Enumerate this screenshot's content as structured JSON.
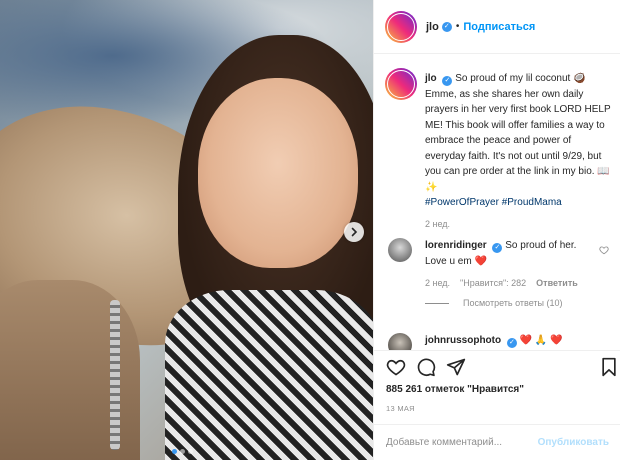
{
  "post": {
    "username": "jlo",
    "follow_label": "Подписаться",
    "caption": {
      "username": "jlo",
      "text_1": "So proud of my lil coconut",
      "emoji_1": "🥥",
      "text_2": "Emme, as she shares her own daily prayers in her very first book LORD HELP ME! This book will offer families a way to embrace the peace and power of everyday faith. It's not out until 9/29, but you can pre order at the link in my bio.",
      "emoji_2": "📖✨",
      "hashtag_1": "#PowerOfPrayer",
      "hashtag_2": "#ProudMama",
      "time": "2 нед."
    },
    "comments": [
      {
        "username": "lorenridinger",
        "text": "So proud of her. Love u em",
        "emoji": "❤️",
        "time": "2 нед.",
        "likes": "\"Нравится\": 282",
        "reply": "Ответить",
        "view_replies": "Посмотреть ответы (10)"
      },
      {
        "username": "johnrussophoto",
        "text": "❤️ 🙏 ❤️"
      }
    ],
    "likes_count": "885 261 отметок \"Нравится\"",
    "date": "13 МАЯ",
    "comment_placeholder": "Добавьте комментарий...",
    "publish_label": "Опубликовать"
  },
  "icons": {
    "like": "heart-icon",
    "comment": "comment-icon",
    "share": "paper-plane-icon",
    "save": "bookmark-icon",
    "next": "chevron-right-icon"
  },
  "colors": {
    "accent": "#0095f6",
    "verified": "#3897f0",
    "link": "#00376b",
    "muted": "#8e8e8e",
    "publish_disabled": "#b2dffc",
    "heart": "#ed4956"
  },
  "carousel": {
    "slides": 3,
    "active_index": 0
  }
}
